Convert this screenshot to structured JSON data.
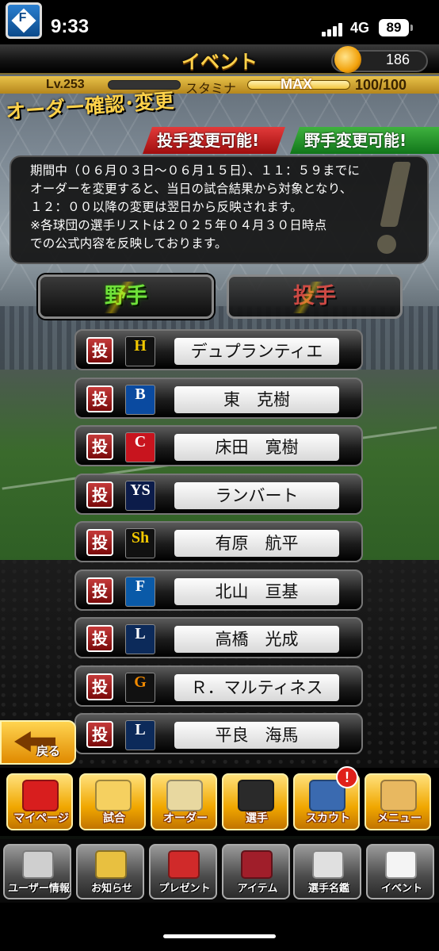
{
  "status": {
    "time": "9:33",
    "network": "4G",
    "battery": "89"
  },
  "header": {
    "title": "イベント",
    "coins": "186",
    "level_label": "Lv.",
    "level": "253",
    "stamina_label": "スタミナ",
    "stamina_max": "MAX",
    "stamina_value": "100/100"
  },
  "page": {
    "title": "オーダー確認･変更",
    "tag_pitcher": "投手変更可能!",
    "tag_fielder": "野手変更可能!",
    "notice": "期間中（０６月０３日〜０６月１５日）、１１：５９までに\nオーダーを変更すると、当日の試合結果から対象となり、\n１２：００以降の変更は翌日から反映されます。\n※各球団の選手リストは２０２５年０４月３０日時点\nでの公式内容を反映しております。"
  },
  "tabs": {
    "fielder": "野手",
    "pitcher": "投手"
  },
  "players": [
    {
      "pos": "投",
      "team_mark": "H",
      "team_color": "#111111",
      "mark_color": "#f2c800",
      "name": "デュプランティエ"
    },
    {
      "pos": "投",
      "team_mark": "B",
      "team_color": "#0a4aa0",
      "mark_color": "#ffffff",
      "name": "東　克樹"
    },
    {
      "pos": "投",
      "team_mark": "C",
      "team_color": "#c8141e",
      "mark_color": "#ffffff",
      "name": "床田　寛樹"
    },
    {
      "pos": "投",
      "team_mark": "YS",
      "team_color": "#0c1c4a",
      "mark_color": "#ffffff",
      "name": "ランバート"
    },
    {
      "pos": "投",
      "team_mark": "Sh",
      "team_color": "#111111",
      "mark_color": "#f2c800",
      "name": "有原　航平"
    },
    {
      "pos": "投",
      "team_mark": "F",
      "team_color": "#0a5aa8",
      "mark_color": "#ffffff",
      "name": "北山　亘基"
    },
    {
      "pos": "投",
      "team_mark": "L",
      "team_color": "#0c2a5a",
      "mark_color": "#ffffff",
      "name": "高橋　光成"
    },
    {
      "pos": "投",
      "team_mark": "G",
      "team_color": "#111111",
      "mark_color": "#f28a00",
      "name": "Ｒ．マルティネス"
    },
    {
      "pos": "投",
      "team_mark": "L",
      "team_color": "#0c2a5a",
      "mark_color": "#ffffff",
      "name": "平良　海馬"
    }
  ],
  "back_label": "戻る",
  "main_nav": [
    {
      "label": "マイページ",
      "icon": "mypage-icon"
    },
    {
      "label": "試合",
      "icon": "game-icon"
    },
    {
      "label": "オーダー",
      "icon": "order-icon"
    },
    {
      "label": "選手",
      "icon": "player-icon"
    },
    {
      "label": "スカウト",
      "icon": "scout-icon"
    },
    {
      "label": "メニュー",
      "icon": "menu-icon"
    }
  ],
  "notification_badge": "!",
  "sub_nav": [
    {
      "label": "ユーザー情報",
      "icon": "user-info-icon"
    },
    {
      "label": "お知らせ",
      "icon": "news-icon"
    },
    {
      "label": "プレゼント",
      "icon": "present-icon"
    },
    {
      "label": "アイテム",
      "icon": "item-icon"
    },
    {
      "label": "選手名鑑",
      "icon": "player-directory-icon"
    },
    {
      "label": "イベント",
      "icon": "event-icon"
    }
  ]
}
